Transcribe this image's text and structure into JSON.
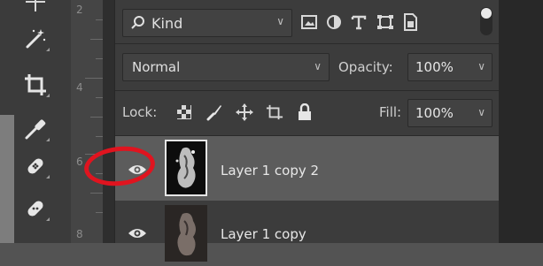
{
  "ruler": {
    "numbers": [
      "2",
      "4",
      "6",
      "8"
    ]
  },
  "tools": [
    {
      "icon": "move-icon"
    },
    {
      "icon": "magic-wand-icon"
    },
    {
      "icon": "crop-icon"
    },
    {
      "icon": "eyedropper-icon"
    },
    {
      "icon": "spot-healing-icon"
    },
    {
      "icon": "bandage-icon"
    }
  ],
  "filter": {
    "kind_label": "Kind",
    "icons": [
      "image-filter-icon",
      "adjustment-filter-icon",
      "type-filter-icon",
      "shape-filter-icon",
      "smart-object-filter-icon"
    ]
  },
  "blend": {
    "mode": "Normal",
    "opacity_label": "Opacity:",
    "opacity_value": "100%"
  },
  "lock": {
    "label": "Lock:",
    "icons": [
      "lock-transparent-pixels-icon",
      "lock-image-pixels-icon",
      "lock-position-icon",
      "lock-artboard-icon",
      "lock-all-icon"
    ],
    "fill_label": "Fill:",
    "fill_value": "100%"
  },
  "layers": [
    {
      "name": "Layer 1 copy 2",
      "selected": true,
      "visible": true
    },
    {
      "name": "Layer 1 copy",
      "selected": false,
      "visible": true
    }
  ],
  "colors": {
    "panel": "#3c3c3c",
    "selected_row": "#5c5c5c",
    "annotation": "#e0141f"
  }
}
